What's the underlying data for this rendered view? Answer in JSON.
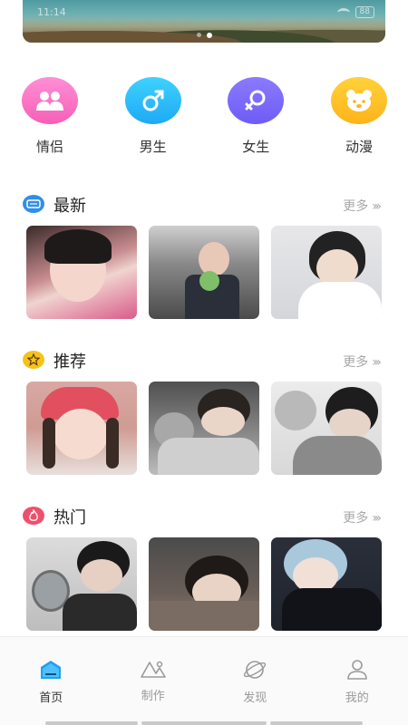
{
  "status": {
    "time": "11:14",
    "battery": "88"
  },
  "banner": {
    "dots": 2,
    "active_dot": 1
  },
  "categories": [
    {
      "label": "情侣",
      "icon": "couple-icon",
      "color": "#f65fb7"
    },
    {
      "label": "男生",
      "icon": "male-icon",
      "color": "#1fa9f4"
    },
    {
      "label": "女生",
      "icon": "female-icon",
      "color": "#6e5cf5"
    },
    {
      "label": "动漫",
      "icon": "bear-icon",
      "color": "#ffb31a"
    }
  ],
  "sections": [
    {
      "title": "最新",
      "more": "更多",
      "icon": "new-badge-icon",
      "icon_color": "#2f8fe8"
    },
    {
      "title": "推荐",
      "more": "更多",
      "icon": "star-badge-icon",
      "icon_color": "#f6c21a"
    },
    {
      "title": "热门",
      "more": "更多",
      "icon": "flame-badge-icon",
      "icon_color": "#ef4f6d"
    }
  ],
  "nav": [
    {
      "label": "首页",
      "icon": "home-icon",
      "active": true
    },
    {
      "label": "制作",
      "icon": "create-icon",
      "active": false
    },
    {
      "label": "发现",
      "icon": "discover-icon",
      "active": false
    },
    {
      "label": "我的",
      "icon": "profile-icon",
      "active": false
    }
  ]
}
